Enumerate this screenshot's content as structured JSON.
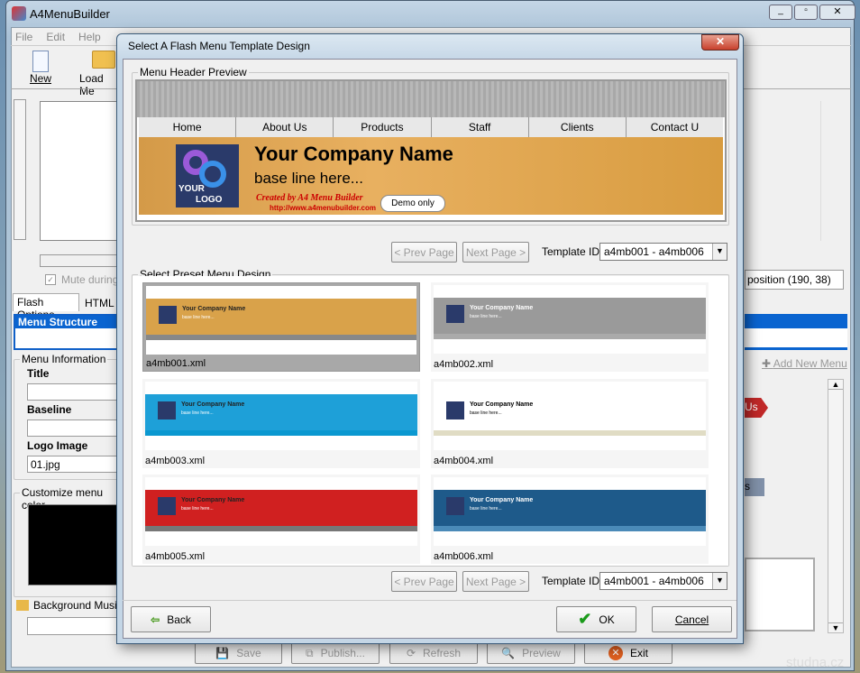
{
  "app": {
    "title": "A4MenuBuilder",
    "menu": [
      "File",
      "Edit",
      "Help"
    ],
    "toolbar": {
      "new": "New",
      "load": "Load Me"
    },
    "mute": "Mute during",
    "position": "position (190, 38)",
    "tabs": [
      "Flash Options",
      "HTML"
    ],
    "menu_structure": "Menu Structure",
    "menu_info": "Menu Information",
    "title_label": "Title",
    "baseline_label": "Baseline",
    "logo_label": "Logo Image",
    "logo_value": "01.jpg",
    "customize": "Customize menu color",
    "bg_music": "Background Music",
    "add_menu": "Add New Menu",
    "tag_us": "Us",
    "tag_s": "s",
    "bottom": {
      "save": "Save",
      "publish": "Publish...",
      "refresh": "Refresh",
      "preview": "Preview",
      "exit": "Exit"
    },
    "watermark": "studna.cz"
  },
  "dialog": {
    "title": "Select A Flash Menu Template Design",
    "close": "✕",
    "preview_group": "Menu Header Preview",
    "preview": {
      "nav": [
        "Home",
        "About Us",
        "Products",
        "Staff",
        "Clients",
        "Contact U"
      ],
      "company": "Your Company Name",
      "baseline": "base line here...",
      "logo_top": "YOUR",
      "logo_bottom": "LOGO",
      "created": "Created by A4 Menu Builder",
      "url": "http://www.a4menubuilder.com",
      "demo": "Demo only"
    },
    "prev_page": "< Prev Page",
    "next_page": "Next Page >",
    "template_label": "Template ID",
    "template_value": "a4mb001 - a4mb006",
    "preset_group": "Select Preset Menu Design",
    "thumb_company": "Your Company Name",
    "thumb_base": "base line here...",
    "templates": [
      {
        "name": "a4mb001.xml",
        "color": "#d9a24a",
        "bar": "#888"
      },
      {
        "name": "a4mb002.xml",
        "color": "#9a9a9a",
        "bar": "#aaa"
      },
      {
        "name": "a4mb003.xml",
        "color": "#1ea0d8",
        "bar": "#0a98d0"
      },
      {
        "name": "a4mb004.xml",
        "color": "#ffffff",
        "bar": "#e0dcc4"
      },
      {
        "name": "a4mb005.xml",
        "color": "#d02020",
        "bar": "#777"
      },
      {
        "name": "a4mb006.xml",
        "color": "#1e5a8a",
        "bar": "#4a8ab8"
      }
    ],
    "back": "Back",
    "ok": "OK",
    "cancel": "Cancel"
  }
}
